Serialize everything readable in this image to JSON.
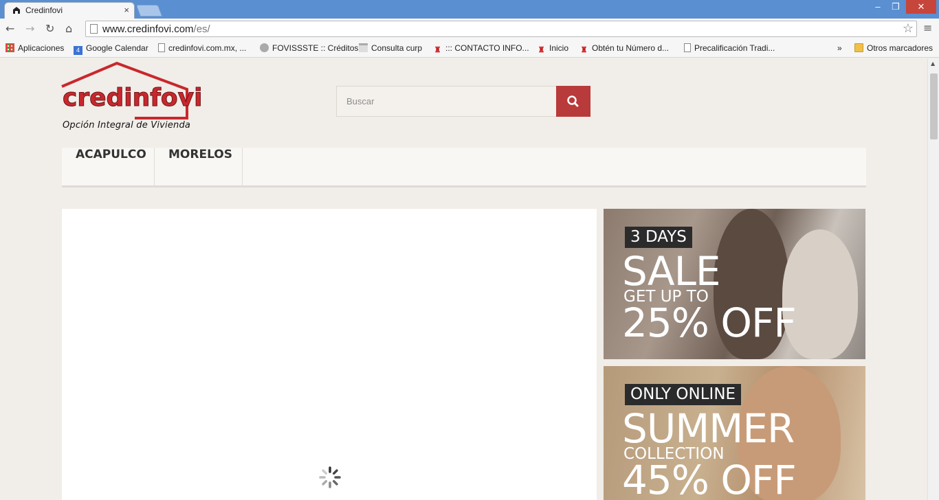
{
  "browser": {
    "tab_title": "Credinfovi",
    "tab_close": "×",
    "window_controls": {
      "minimize": "–",
      "restore": "❐",
      "close": "✕"
    },
    "url_host": "www.credinfovi.com",
    "url_path": "/es/",
    "nav_icons": [
      "back-arrow-icon",
      "forward-arrow-icon",
      "reload-icon",
      "home-icon"
    ],
    "bookmarks": [
      {
        "label": "Aplicaciones",
        "icon": "apps-grid-icon"
      },
      {
        "label": "Google Calendar",
        "icon": "calendar-icon",
        "badge": "4"
      },
      {
        "label": "credinfovi.com.mx, ...",
        "icon": "page-icon"
      },
      {
        "label": "FOVISSSTE :: Créditos",
        "icon": "shield-icon"
      },
      {
        "label": "Consulta curp",
        "icon": "page-flat-icon"
      },
      {
        "label": "::: CONTACTO INFO...",
        "icon": "infonavit-icon"
      },
      {
        "label": "Inicio",
        "icon": "infonavit-icon"
      },
      {
        "label": "Obtén tu Número d...",
        "icon": "infonavit-icon"
      },
      {
        "label": "Precalificación Tradi...",
        "icon": "page-icon"
      }
    ],
    "bookmarks_overflow": "»",
    "other_bookmarks": "Otros marcadores"
  },
  "site": {
    "logo_text": "credinfovi",
    "logo_tagline": "Opción Integral de Vivienda",
    "search_placeholder": "Buscar",
    "menu": [
      "ACAPULCO",
      "MORELOS"
    ],
    "colors": {
      "brand_red": "#b83a3a",
      "logo_red": "#c8282d"
    }
  },
  "banners": [
    {
      "tag": "3 DAYS",
      "headline": "SALE",
      "subline": "GET UP TO",
      "offer": "25% OFF"
    },
    {
      "tag": "ONLY ONLINE",
      "headline": "SUMMER",
      "subline": "COLLECTION",
      "offer": "45% OFF"
    }
  ]
}
